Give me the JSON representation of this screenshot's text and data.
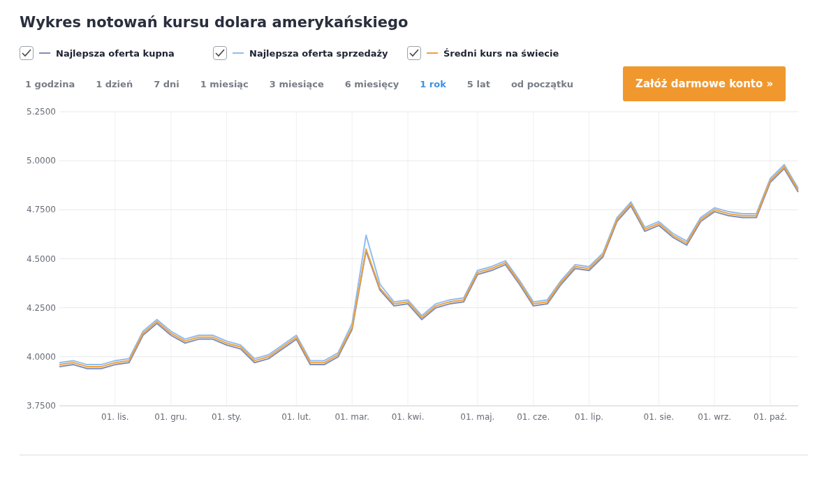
{
  "title": "Wykres notowań kursu dolara amerykańskiego",
  "legend": [
    {
      "checked": true
    },
    {
      "checked": true
    },
    {
      "checked": true
    }
  ],
  "ranges": [
    {
      "label": "1 godzina",
      "selected": false
    },
    {
      "label": "1 dzień",
      "selected": false
    },
    {
      "label": "7 dni",
      "selected": false
    },
    {
      "label": "1 miesiąc",
      "selected": false
    },
    {
      "label": "3 miesiące",
      "selected": false
    },
    {
      "label": "6 miesięcy",
      "selected": false
    },
    {
      "label": "1 rok",
      "selected": true
    },
    {
      "label": "5 lat",
      "selected": false
    },
    {
      "label": "od początku",
      "selected": false
    }
  ],
  "signup_button": "Załóż darmowe konto »",
  "chart_data": {
    "type": "line",
    "categories": [
      null,
      null,
      null,
      null,
      "01. lis.",
      null,
      null,
      null,
      "01. gru.",
      null,
      null,
      null,
      "01. sty.",
      null,
      null,
      null,
      null,
      "01. lut.",
      null,
      null,
      null,
      "01. mar.",
      null,
      null,
      null,
      "01. kwi.",
      null,
      null,
      null,
      null,
      "01. maj.",
      null,
      null,
      null,
      "01. cze.",
      null,
      null,
      null,
      "01. lip.",
      null,
      null,
      null,
      null,
      "01. sie.",
      null,
      null,
      null,
      "01. wrz.",
      null,
      null,
      null,
      "01. paź.",
      null,
      null
    ],
    "series": [
      {
        "name": "Najlepsza oferta kupna",
        "color": "#7f8db8",
        "values": [
          3.95,
          3.96,
          3.94,
          3.94,
          3.96,
          3.97,
          4.11,
          4.17,
          4.11,
          4.07,
          4.09,
          4.09,
          4.06,
          4.04,
          3.97,
          3.99,
          4.04,
          4.09,
          3.96,
          3.96,
          4.0,
          4.14,
          4.54,
          4.34,
          4.26,
          4.27,
          4.19,
          4.25,
          4.27,
          4.28,
          4.42,
          4.44,
          4.47,
          4.37,
          4.26,
          4.27,
          4.37,
          4.45,
          4.44,
          4.51,
          4.69,
          4.77,
          4.64,
          4.67,
          4.61,
          4.57,
          4.69,
          4.74,
          4.72,
          4.71,
          4.71,
          4.89,
          4.96,
          4.84
        ]
      },
      {
        "name": "Najlepsza oferta sprzedaży",
        "color": "#8fbcf0",
        "values": [
          3.97,
          3.98,
          3.96,
          3.96,
          3.98,
          3.99,
          4.13,
          4.19,
          4.13,
          4.09,
          4.11,
          4.11,
          4.08,
          4.06,
          3.99,
          4.01,
          4.06,
          4.11,
          3.98,
          3.98,
          4.02,
          4.17,
          4.62,
          4.37,
          4.28,
          4.29,
          4.21,
          4.27,
          4.29,
          4.3,
          4.44,
          4.46,
          4.49,
          4.39,
          4.28,
          4.29,
          4.39,
          4.47,
          4.46,
          4.53,
          4.71,
          4.79,
          4.66,
          4.69,
          4.63,
          4.59,
          4.71,
          4.76,
          4.74,
          4.73,
          4.73,
          4.91,
          4.98,
          4.86
        ]
      },
      {
        "name": "Średni kurs na świecie",
        "color": "#f0a13a",
        "values": [
          3.96,
          3.97,
          3.95,
          3.95,
          3.97,
          3.98,
          4.12,
          4.18,
          4.12,
          4.08,
          4.1,
          4.1,
          4.07,
          4.05,
          3.98,
          4.0,
          4.05,
          4.1,
          3.97,
          3.97,
          4.01,
          4.15,
          4.55,
          4.35,
          4.27,
          4.28,
          4.2,
          4.26,
          4.28,
          4.29,
          4.43,
          4.45,
          4.48,
          4.38,
          4.27,
          4.28,
          4.38,
          4.46,
          4.45,
          4.52,
          4.7,
          4.78,
          4.65,
          4.68,
          4.62,
          4.58,
          4.7,
          4.75,
          4.73,
          4.72,
          4.72,
          4.9,
          4.97,
          4.85
        ]
      }
    ],
    "ylim": [
      3.75,
      5.25
    ],
    "grid": true,
    "yticks": [
      {
        "value": 3.75,
        "label": "3.7500"
      },
      {
        "value": 4.0,
        "label": "4.0000"
      },
      {
        "value": 4.25,
        "label": "4.2500"
      },
      {
        "value": 4.5,
        "label": "4.5000"
      },
      {
        "value": 4.75,
        "label": "4.7500"
      },
      {
        "value": 5.0,
        "label": "5.0000"
      },
      {
        "value": 5.25,
        "label": "5.2500"
      }
    ]
  }
}
